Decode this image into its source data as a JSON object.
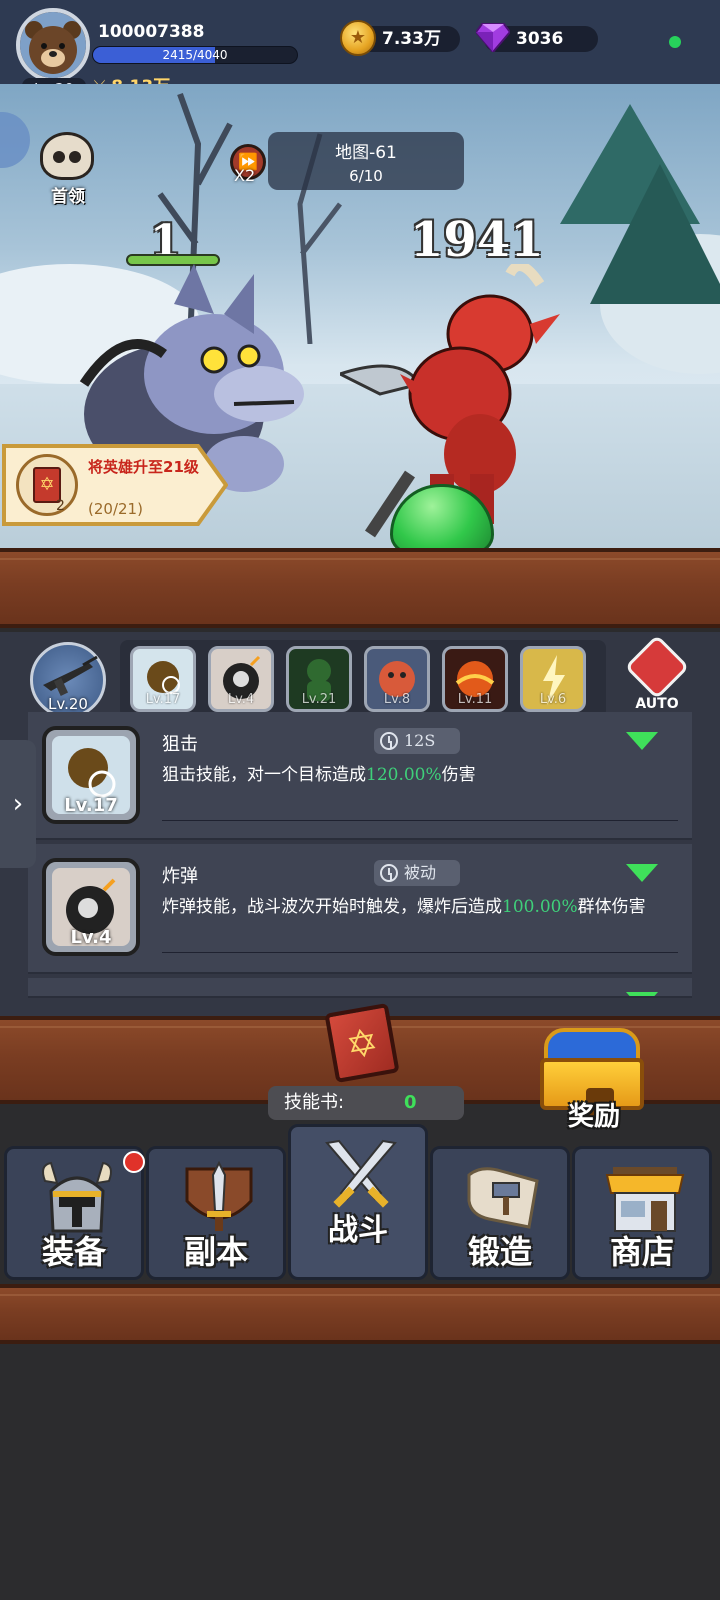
{
  "player": {
    "id": "100007388",
    "level_label": "Lv.20",
    "exp_text": "2415/4040",
    "exp_fraction": 0.598,
    "power": "8.13万",
    "avatar_icon": "bear-avatar-icon"
  },
  "currency": {
    "gold": "7.33万",
    "gems": "3036"
  },
  "battle": {
    "boss_label": "首领",
    "speed_label": "X2",
    "map_name": "地图-61",
    "wave": "6/10",
    "hero_damage": "1",
    "enemy_damage": "1941"
  },
  "quest": {
    "title": "将英雄升至21级",
    "progress": "(20/21)",
    "count": "2",
    "icon": "spellbook-icon"
  },
  "skills": {
    "weapon_level": "Lv.20",
    "slots": [
      {
        "icon": "sniper-skill-icon",
        "level": "Lv.17"
      },
      {
        "icon": "bomb-skill-icon",
        "level": "Lv.4"
      },
      {
        "icon": "poison-skill-icon",
        "level": "Lv.21"
      },
      {
        "icon": "fire-creature-skill-icon",
        "level": "Lv.8"
      },
      {
        "icon": "meteor-skill-icon",
        "level": "Lv.11"
      },
      {
        "icon": "lightning-skill-icon",
        "level": "Lv.6"
      }
    ],
    "auto_label": "AUTO",
    "list": [
      {
        "name": "狙击",
        "cooldown": "12S",
        "level": "Lv.17",
        "desc_prefix": "狙击技能，对一个目标造成",
        "desc_pct": "120.00%",
        "desc_suffix": "伤害"
      },
      {
        "name": "炸弹",
        "cooldown": "被动",
        "level": "Lv.4",
        "desc_prefix": "炸弹技能，战斗波次开始时触发，爆炸后造成",
        "desc_pct": "100.00%",
        "desc_suffix": "群体伤害"
      }
    ]
  },
  "skillbook": {
    "label": "技能书:",
    "value": "0"
  },
  "reward_label": "奖励",
  "nav": [
    {
      "label": "装备",
      "icon": "helmet-icon",
      "badge": true
    },
    {
      "label": "副本",
      "icon": "sword-shield-icon",
      "badge": false
    },
    {
      "label": "战斗",
      "icon": "crossed-swords-icon",
      "badge": false,
      "active": true
    },
    {
      "label": "锻造",
      "icon": "forge-scroll-icon",
      "badge": false
    },
    {
      "label": "商店",
      "icon": "shop-icon",
      "badge": false
    }
  ],
  "colors": {
    "accent_green": "#3fd07a",
    "quest_red": "#c8261c",
    "wood": "#7a3d22"
  }
}
